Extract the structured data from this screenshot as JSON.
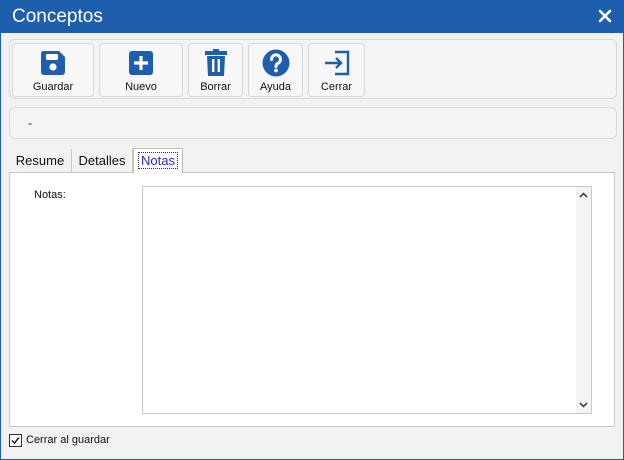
{
  "window": {
    "title": "Conceptos",
    "close_icon": "close-icon",
    "accent": "#1e5fad"
  },
  "toolbar": {
    "buttons": [
      {
        "label": "Guardar",
        "icon": "save-icon"
      },
      {
        "label": "Nuevo",
        "icon": "plus-icon"
      },
      {
        "label": "Borrar",
        "icon": "trash-icon"
      },
      {
        "label": "Ayuda",
        "icon": "help-icon"
      },
      {
        "label": "Cerrar",
        "icon": "exit-icon"
      }
    ]
  },
  "info": {
    "text": "-"
  },
  "tabs": [
    {
      "label": "Resume",
      "active": false
    },
    {
      "label": "Detalles",
      "active": false
    },
    {
      "label": "Notas",
      "active": true
    }
  ],
  "notes": {
    "label": "Notas:",
    "value": ""
  },
  "footer": {
    "checkbox_label": "Cerrar al guardar",
    "checked": true
  }
}
